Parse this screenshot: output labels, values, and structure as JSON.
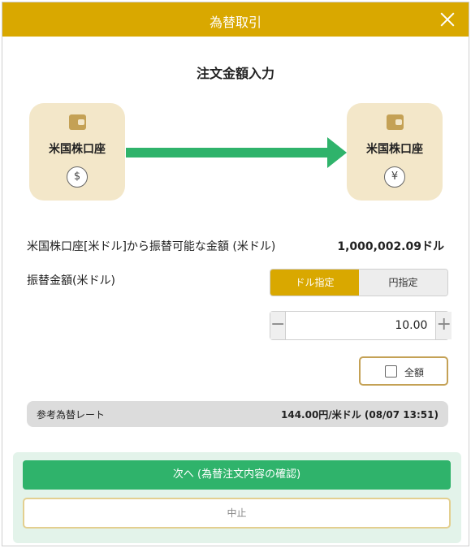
{
  "modal": {
    "title": "為替取引",
    "section_title": "注文金額入力"
  },
  "transfer": {
    "from": {
      "account": "米国株口座",
      "currency_symbol": "$"
    },
    "to": {
      "account": "米国株口座",
      "currency_symbol": "¥"
    }
  },
  "available": {
    "label": "米国株口座[米ドル]から振替可能な金額 (米ドル)",
    "value": "1,000,002.09ドル"
  },
  "amount": {
    "label": "振替金額(米ドル)",
    "toggle": {
      "dollar": "ドル指定",
      "yen": "円指定",
      "selected": "dollar"
    },
    "minus": "−",
    "plus": "+",
    "value": "10.00",
    "all_label": "全額",
    "all_checked": false
  },
  "rate": {
    "label": "参考為替レート",
    "value": "144.00円/米ドル (08/07 13:51)"
  },
  "buttons": {
    "next": "次へ (為替注文内容の確認)",
    "cancel": "中止"
  },
  "colors": {
    "header": "#d9a800",
    "accent_green": "#2fb36b",
    "card_bg": "#f3e7c9",
    "arrow": "#2fb36b"
  },
  "icons": {
    "close": "close-icon",
    "wallet": "wallet-icon",
    "arrow": "arrow-right-icon"
  }
}
